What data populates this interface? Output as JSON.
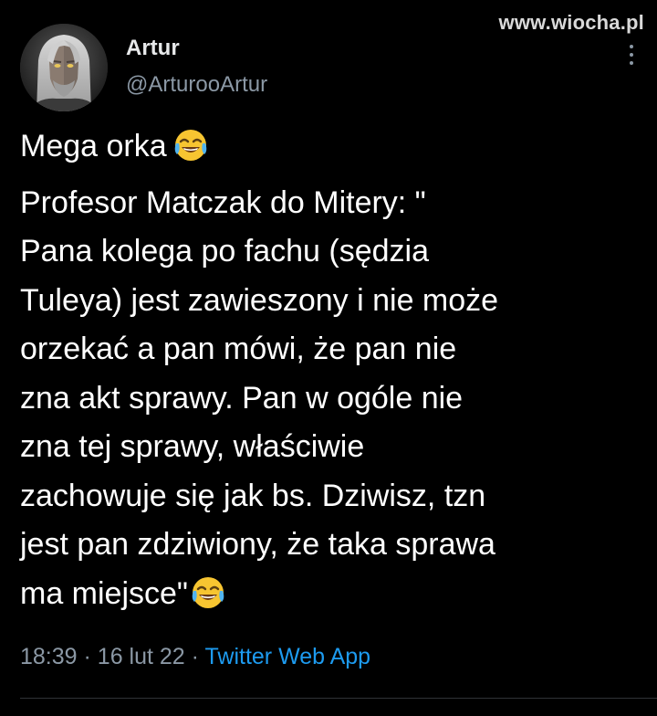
{
  "watermark": "www.wiocha.pl",
  "author": {
    "display_name": "Artur",
    "handle": "@ArturooArtur"
  },
  "tweet": {
    "lines": [
      "Mega orka",
      "Profesor Matczak do Mitery: \"",
      "Pana kolega po fachu (sędzia",
      "Tuleya) jest zawieszony i nie może",
      "orzekać a pan mówi, że pan nie",
      "zna akt sprawy. Pan w ogóle nie",
      "zna tej sprawy, właściwie",
      "zachowuje się jak bs. Dziwisz, tzn",
      "jest pan zdziwiony, że taka sprawa",
      "ma miejsce\""
    ],
    "emoji": "face-with-tears-of-joy-emoji"
  },
  "meta": {
    "time": "18:39",
    "separator": "·",
    "date": "16 lut 22",
    "source": "Twitter Web App"
  },
  "colors": {
    "background": "#000000",
    "text": "#ffffff",
    "secondary": "#8b98a5",
    "link": "#1d9bf0"
  },
  "icons": {
    "more": "more-vertical-icon"
  }
}
